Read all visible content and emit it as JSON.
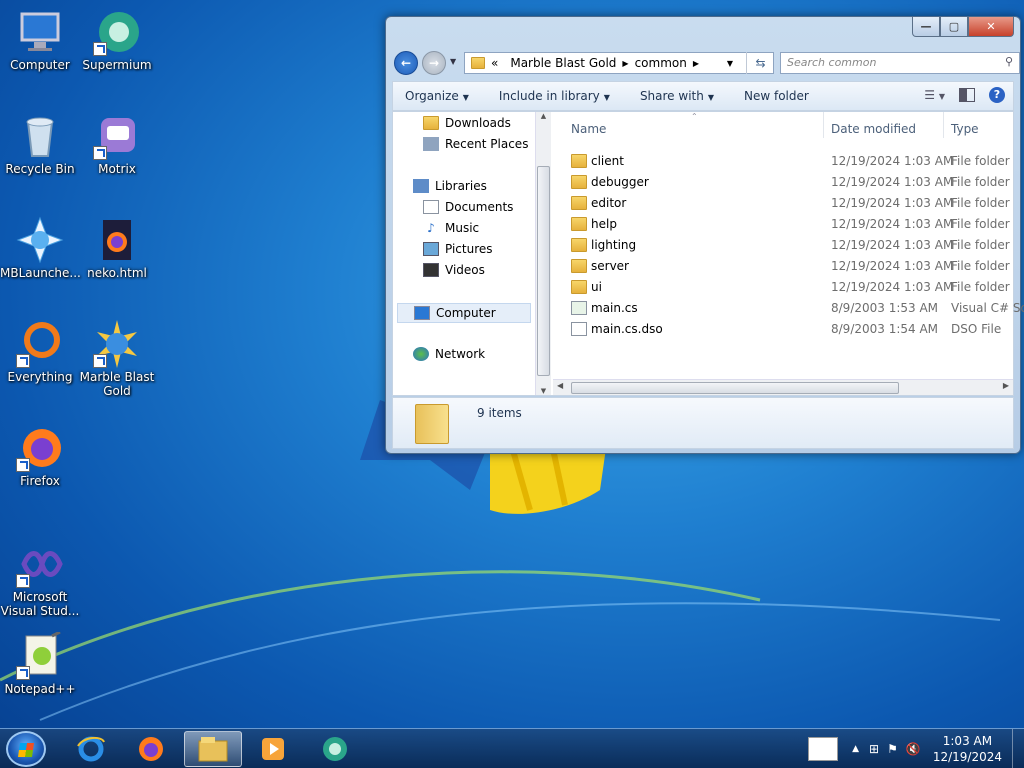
{
  "desktop_icons": [
    {
      "label": "Computer"
    },
    {
      "label": "Supermium"
    },
    {
      "label": "Recycle Bin"
    },
    {
      "label": "Motrix"
    },
    {
      "label": "MBLaunche..."
    },
    {
      "label": "neko.html"
    },
    {
      "label": "Everything"
    },
    {
      "label": "Marble Blast Gold"
    },
    {
      "label": "Firefox"
    },
    {
      "label": "Microsoft Visual Stud..."
    },
    {
      "label": "Notepad++"
    }
  ],
  "window": {
    "address": {
      "prefix": "«",
      "crumbs": [
        "Marble Blast Gold",
        "common"
      ]
    },
    "search_placeholder": "Search common",
    "toolbar": {
      "organize": "Organize",
      "include_in_library": "Include in library",
      "share_with": "Share with",
      "new_folder": "New folder"
    },
    "nav": {
      "downloads": "Downloads",
      "recent_places": "Recent Places",
      "libraries": "Libraries",
      "documents": "Documents",
      "music": "Music",
      "pictures": "Pictures",
      "videos": "Videos",
      "computer": "Computer",
      "network": "Network"
    },
    "columns": {
      "name": "Name",
      "date": "Date modified",
      "type": "Type"
    },
    "files": [
      {
        "name": "client",
        "date": "12/19/2024 1:03 AM",
        "type": "File folder"
      },
      {
        "name": "debugger",
        "date": "12/19/2024 1:03 AM",
        "type": "File folder"
      },
      {
        "name": "editor",
        "date": "12/19/2024 1:03 AM",
        "type": "File folder"
      },
      {
        "name": "help",
        "date": "12/19/2024 1:03 AM",
        "type": "File folder"
      },
      {
        "name": "lighting",
        "date": "12/19/2024 1:03 AM",
        "type": "File folder"
      },
      {
        "name": "server",
        "date": "12/19/2024 1:03 AM",
        "type": "File folder"
      },
      {
        "name": "ui",
        "date": "12/19/2024 1:03 AM",
        "type": "File folder"
      },
      {
        "name": "main.cs",
        "date": "8/9/2003 1:53 AM",
        "type": "Visual C# So"
      },
      {
        "name": "main.cs.dso",
        "date": "8/9/2003 1:54 AM",
        "type": "DSO File"
      }
    ],
    "details": {
      "count": "9 items"
    }
  },
  "taskbar": {
    "time": "1:03 AM",
    "date": "12/19/2024"
  },
  "colors": {
    "accent": "#1f7fd0",
    "folder": "#e6b13c"
  }
}
